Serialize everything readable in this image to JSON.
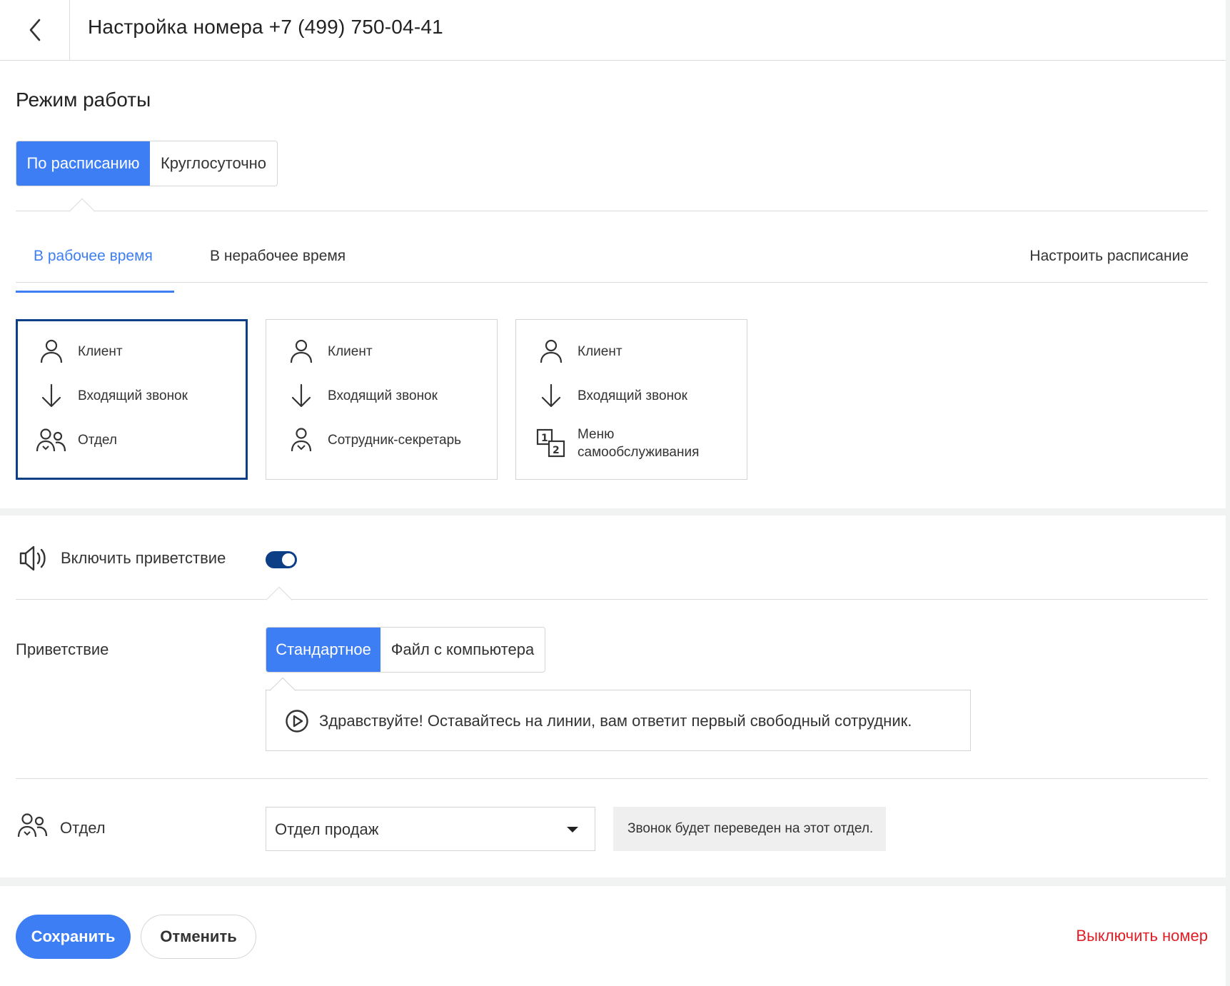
{
  "header": {
    "title": "Настройка номера +7 (499) 750-04-41"
  },
  "mode": {
    "title": "Режим работы",
    "options": [
      "По расписанию",
      "Круглосуточно"
    ],
    "selected": "По расписанию"
  },
  "tabs": {
    "items": [
      "В рабочее время",
      "В нерабочее время"
    ],
    "active": "В рабочее время",
    "schedule_link": "Настроить расписание"
  },
  "cards": [
    {
      "rows": [
        {
          "icon": "person-icon",
          "label": "Клиент"
        },
        {
          "icon": "arrow-down-icon",
          "label": "Входящий звонок"
        },
        {
          "icon": "group-icon",
          "label": "Отдел"
        }
      ],
      "selected": true
    },
    {
      "rows": [
        {
          "icon": "person-icon",
          "label": "Клиент"
        },
        {
          "icon": "arrow-down-icon",
          "label": "Входящий звонок"
        },
        {
          "icon": "secretary-icon",
          "label": "Сотрудник-секретарь"
        }
      ],
      "selected": false
    },
    {
      "rows": [
        {
          "icon": "person-icon",
          "label": "Клиент"
        },
        {
          "icon": "arrow-down-icon",
          "label": "Входящий звонок"
        },
        {
          "icon": "menu-12-icon",
          "label": "Меню",
          "label2": "самообслуживания"
        }
      ],
      "selected": false
    }
  ],
  "greeting": {
    "toggle_label": "Включить приветствие",
    "enabled": true,
    "title": "Приветствие",
    "options": [
      "Стандартное",
      "Файл с компьютера"
    ],
    "selected": "Стандартное",
    "text": "Здравствуйте! Оставайтесь на линии, вам ответит первый свободный сотрудник."
  },
  "department": {
    "label": "Отдел",
    "value": "Отдел продаж",
    "hint": "Звонок будет переведен на этот отдел."
  },
  "footer": {
    "save": "Сохранить",
    "cancel": "Отменить",
    "disable": "Выключить номер"
  },
  "colors": {
    "accent": "#3d7ef5",
    "dark_blue": "#0d3f86",
    "danger": "#e01e26"
  }
}
